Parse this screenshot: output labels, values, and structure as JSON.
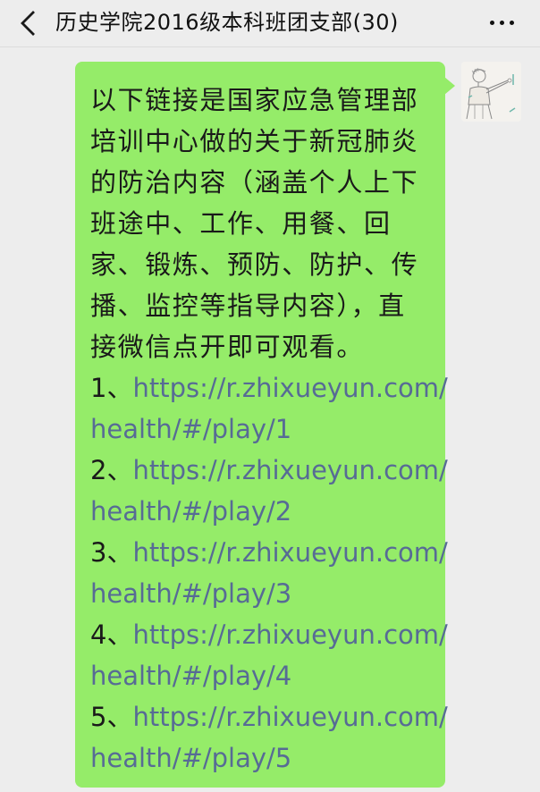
{
  "header": {
    "title": "历史学院2016级本科班团支部(30)",
    "back_icon": "chevron-left-icon",
    "more_icon": "more-dots-icon"
  },
  "message": {
    "bubble_color": "#95ec69",
    "link_color": "#576b95",
    "intro": "以下链接是国家应急管理部培训中心做的关于新冠肺炎的防治内容（涵盖个人上下班途中、工作、用餐、回家、锻炼、预防、防护、传播、监控等指导内容），直接微信点开即可观看。",
    "links": [
      {
        "num": "1、",
        "url_part1": "https://r.zhixueyun.com/",
        "url_part2": "health/#/play/1"
      },
      {
        "num": "2、",
        "url_part1": "https://r.zhixueyun.com/",
        "url_part2": "health/#/play/2"
      },
      {
        "num": "3、",
        "url_part1": "https://r.zhixueyun.com/",
        "url_part2": "health/#/play/3"
      },
      {
        "num": "4、",
        "url_part1": "https://r.zhixueyun.com/",
        "url_part2": "health/#/play/4"
      },
      {
        "num": "5、",
        "url_part1": "https://r.zhixueyun.com/",
        "url_part2": "health/#/play/5"
      }
    ]
  },
  "sender": {
    "avatar_icon": "user-avatar-sketch"
  }
}
